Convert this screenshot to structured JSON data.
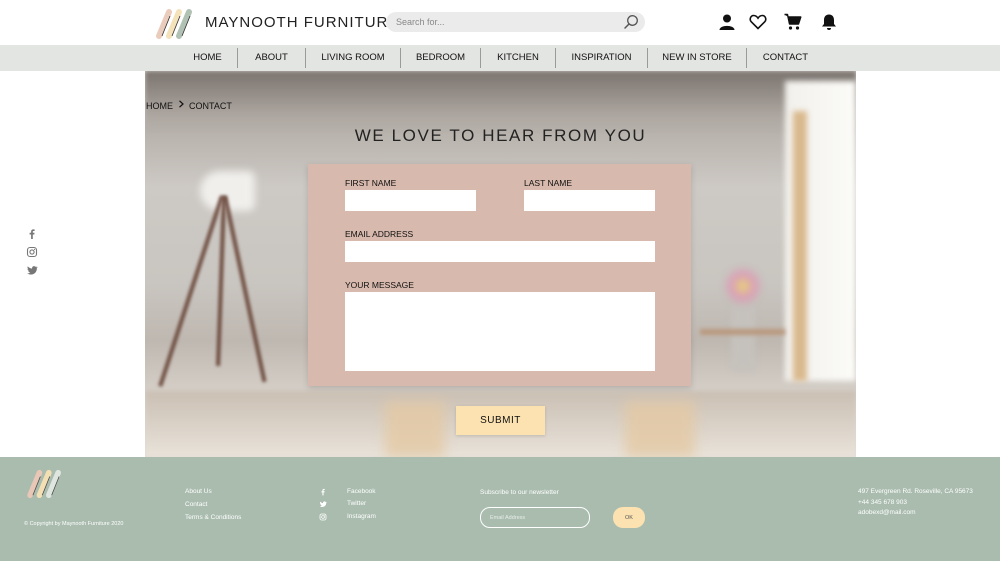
{
  "header": {
    "brand": "MAYNOOTH FURNITURE",
    "search_placeholder": "Search for...",
    "icons": [
      "user-icon",
      "heart-icon",
      "cart-icon",
      "bell-icon"
    ]
  },
  "nav": {
    "items": [
      "HOME",
      "ABOUT",
      "LIVING ROOM",
      "BEDROOM",
      "KITCHEN",
      "INSPIRATION",
      "NEW IN STORE",
      "CONTACT"
    ]
  },
  "breadcrumb": {
    "home": "HOME",
    "current": "CONTACT"
  },
  "hero": {
    "title": "WE LOVE TO HEAR FROM YOU"
  },
  "form": {
    "first_name_label": "FIRST NAME",
    "last_name_label": "LAST NAME",
    "email_label": "EMAIL ADDRESS",
    "message_label": "YOUR MESSAGE",
    "first_name_value": "",
    "last_name_value": "",
    "email_value": "",
    "message_value": "",
    "submit_label": "SUBMIT"
  },
  "side_social": [
    "facebook-icon",
    "instagram-icon",
    "twitter-icon"
  ],
  "footer": {
    "copyright": "© Copyright by Maynooth Furniture 2020",
    "links": [
      "About Us",
      "Contact",
      "Terms & Conditions"
    ],
    "social": [
      {
        "icon": "facebook-icon",
        "label": "Facebook"
      },
      {
        "icon": "twitter-icon",
        "label": "Twitter"
      },
      {
        "icon": "instagram-icon",
        "label": "Instagram"
      }
    ],
    "newsletter_label": "Subscribe to our newsletter",
    "newsletter_placeholder": "Email Address",
    "newsletter_button": "OK",
    "address": "497 Evergreen Rd. Roseville, CA 95673",
    "phone": "+44 345 678 903",
    "email": "adobexd@mail.com"
  },
  "colors": {
    "nav_bg": "#e3e5e2",
    "form_bg": "#d8b9ad",
    "submit_bg": "#fbe2b0",
    "footer_bg": "#a9bcae"
  }
}
